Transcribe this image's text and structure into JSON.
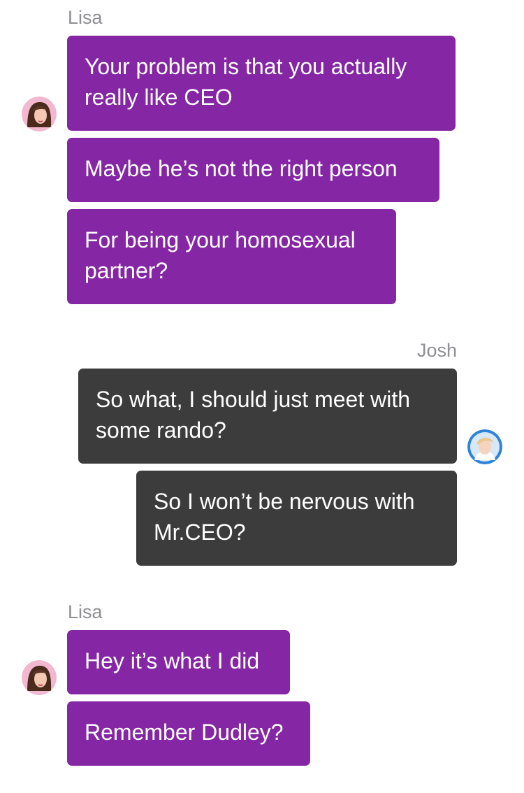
{
  "conversation": [
    {
      "sender": "Lisa",
      "messages": [
        {
          "lines": [
            "Your problem is that you actually",
            "really like CEO"
          ]
        },
        {
          "lines": [
            "Maybe he’s not the right person"
          ]
        },
        {
          "lines": [
            "For being your homosexual",
            "partner?"
          ]
        }
      ]
    },
    {
      "sender": "Josh",
      "messages": [
        {
          "lines": [
            "So what, I should just meet with",
            "some rando?"
          ]
        },
        {
          "lines": [
            "So I won’t be nervous with",
            "Mr.CEO?"
          ]
        }
      ]
    },
    {
      "sender": "Lisa",
      "messages": [
        {
          "lines": [
            "Hey it’s what I did"
          ]
        },
        {
          "lines": [
            "Remember Dudley?"
          ]
        }
      ]
    }
  ],
  "avatars": {
    "lisa": {
      "icon": "lisa-avatar-icon",
      "colors": {
        "ring": "#f2b8cf",
        "hair": "#4a2a1c",
        "skin": "#f3c9b4"
      }
    },
    "josh": {
      "icon": "josh-avatar-icon",
      "colors": {
        "ring": "#2f84d8",
        "hair": "#e8c98a",
        "skin": "#f5d3bd"
      }
    }
  },
  "colors": {
    "lisa_bubble": "#8526a4",
    "josh_bubble": "#3c3c3c",
    "sender_name": "#8e8e93",
    "background": "#ffffff"
  }
}
